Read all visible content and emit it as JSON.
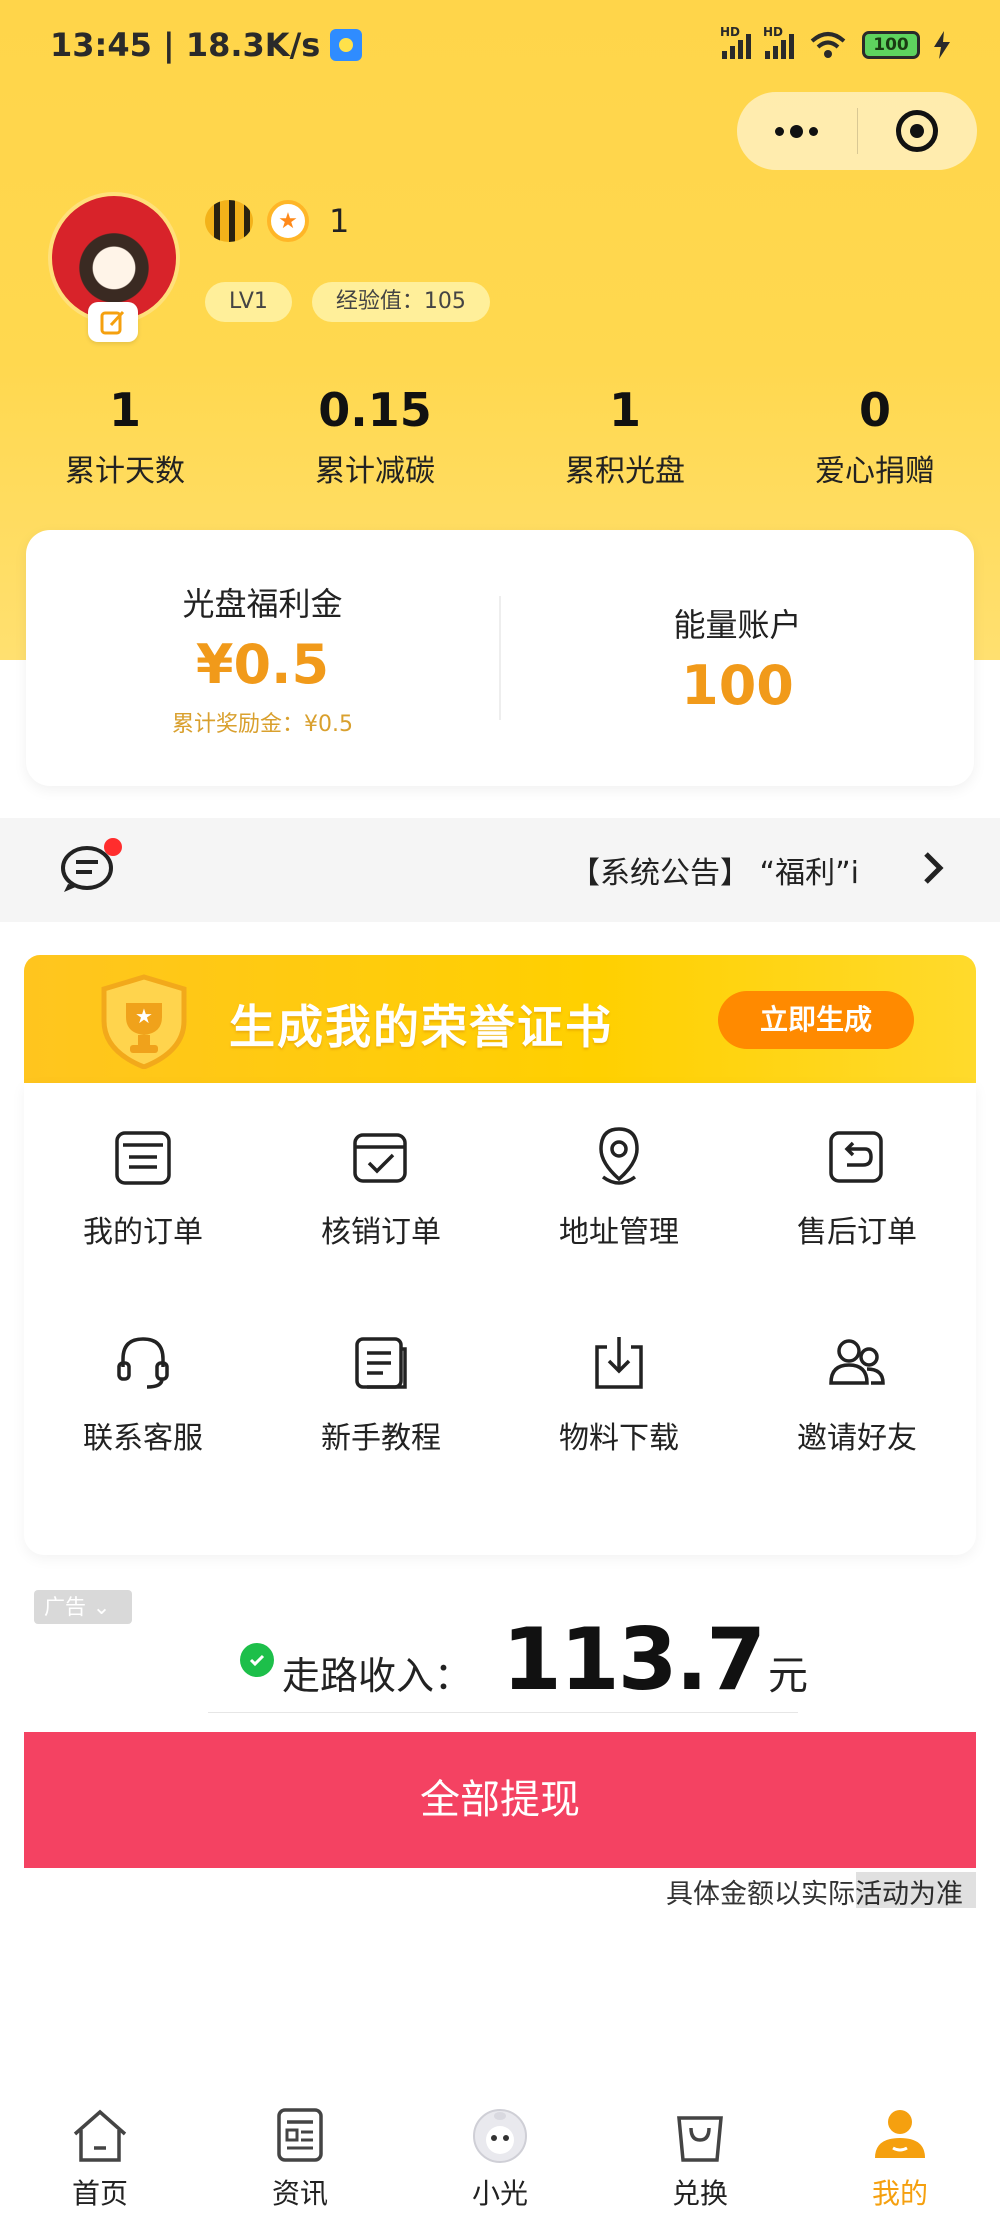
{
  "status_bar": {
    "time_speed": "13:45 | 18.3K/s",
    "battery": "100",
    "signal_tag": "HD"
  },
  "profile": {
    "medal_count": "1",
    "level": "LV1",
    "exp": "经验值：105"
  },
  "stats": [
    {
      "value": "1",
      "label": "累计天数"
    },
    {
      "value": "0.15",
      "label": "累计减碳"
    },
    {
      "value": "1",
      "label": "累积光盘"
    },
    {
      "value": "0",
      "label": "爱心捐赠"
    }
  ],
  "wallet": {
    "welfare_title": "光盘福利金",
    "welfare_amount": "¥0.5",
    "welfare_sub": "累计奖励金：¥0.5",
    "energy_title": "能量账户",
    "energy_amount": "100"
  },
  "notice": {
    "text": "【系统公告】 “福利”i"
  },
  "certificate": {
    "title": "生成我的荣誉证书",
    "button": "立即生成"
  },
  "menu": [
    {
      "label": "我的订单",
      "icon": "order-list-icon"
    },
    {
      "label": "核销订单",
      "icon": "verify-order-icon"
    },
    {
      "label": "地址管理",
      "icon": "location-pin-icon"
    },
    {
      "label": "售后订单",
      "icon": "after-sale-icon"
    },
    {
      "label": "联系客服",
      "icon": "headset-icon"
    },
    {
      "label": "新手教程",
      "icon": "tutorial-doc-icon"
    },
    {
      "label": "物料下载",
      "icon": "download-icon"
    },
    {
      "label": "邀请好友",
      "icon": "invite-friends-icon"
    }
  ],
  "ad": {
    "tag": "广告",
    "walk_label": "走路收入：",
    "walk_amount": "113.7",
    "walk_unit": "元",
    "withdraw_button": "全部提现",
    "note": "具体金额以实际活动为准"
  },
  "tabs": [
    {
      "label": "首页",
      "icon": "home-icon"
    },
    {
      "label": "资讯",
      "icon": "news-icon"
    },
    {
      "label": "小光",
      "icon": "mascot-icon"
    },
    {
      "label": "兑换",
      "icon": "shopping-bag-icon"
    },
    {
      "label": "我的",
      "icon": "user-icon",
      "active": true
    }
  ],
  "colors": {
    "accent": "#f5a00f",
    "hero": "#ffd54a",
    "withdraw": "#f44262",
    "amount": "#f19a1a"
  }
}
